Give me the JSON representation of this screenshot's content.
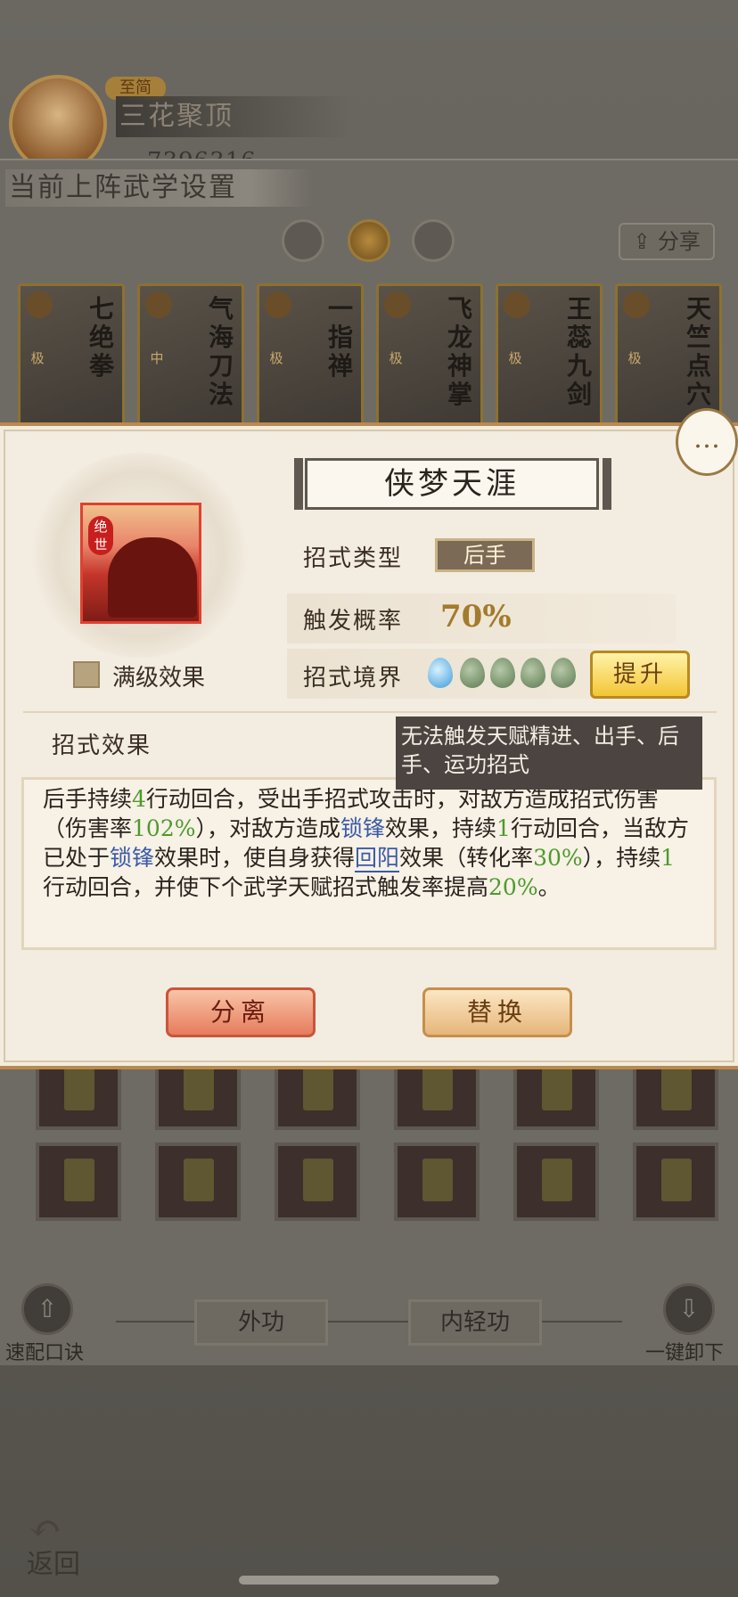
{
  "player": {
    "rank": "至简",
    "name": "三花聚顶",
    "power": "7396316"
  },
  "section_title": "当前上阵武学设置",
  "share_label": "分享",
  "cards": [
    {
      "name": "七绝拳",
      "grade": "极"
    },
    {
      "name": "气海刀法",
      "grade": "中"
    },
    {
      "name": "一指禅",
      "grade": "极"
    },
    {
      "name": "飞龙神掌",
      "grade": "极"
    },
    {
      "name": "王蕊九剑",
      "grade": "极"
    },
    {
      "name": "天竺点穴",
      "grade": "极"
    }
  ],
  "dialog": {
    "skill_seal": "绝世",
    "skill_name": "侠梦天涯",
    "max_effect_label": "满级效果",
    "type_label": "招式类型",
    "type_value": "后手",
    "rate_label": "触发概率",
    "rate_value": "70%",
    "realm_label": "招式境界",
    "realm_level": 1,
    "realm_max": 5,
    "upgrade_label": "提升",
    "effect_label": "招式效果",
    "tooltip": "无法触发天赋精进、出手、后手、运功招式",
    "effect": {
      "p1": "后手持续",
      "n1": "4",
      "p2": "行动回合，受出手招式攻击时，对敌方造成招式伤害（伤害率",
      "n2": "102%",
      "p3": "），对敌方造成",
      "k1": "锁锋",
      "p4": "效果，持续",
      "n3": "1",
      "p5": "行动回合，当敌方已处于",
      "k2": "锁锋",
      "p6": "效果时，使自身获得",
      "k3": "回阳",
      "p7": "效果（转化率",
      "n4": "30%",
      "p8": "），持续",
      "n5": "1",
      "p9": "行动回合，并使下个武学天赋招式触发率提高",
      "n6": "20%",
      "p10": "。"
    },
    "separate_label": "分离",
    "replace_label": "替换"
  },
  "bottom": {
    "quick_label": "速配口诀",
    "tab_external": "外功",
    "tab_internal": "内轻功",
    "unload_label": "一键卸下",
    "back_label": "返回"
  }
}
